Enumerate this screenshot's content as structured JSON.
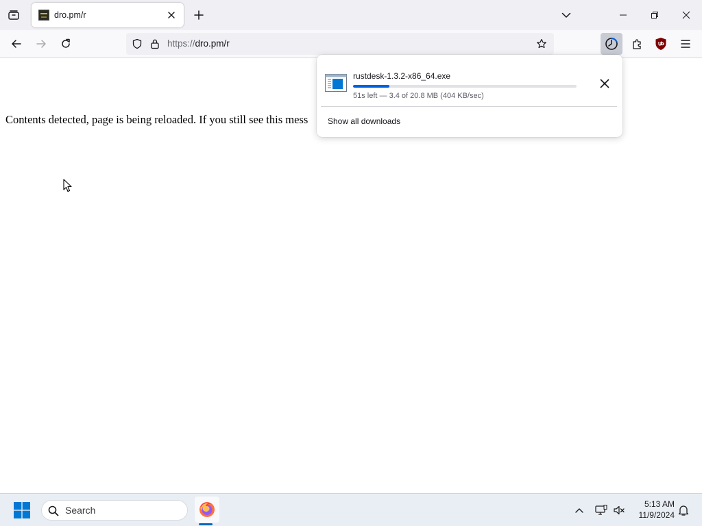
{
  "tab": {
    "title": "dro.pm/r"
  },
  "toolbar": {
    "url_scheme": "https://",
    "url_host": "dro.pm/r"
  },
  "page": {
    "message": "Contents detected, page is being reloaded. If you still see this mess"
  },
  "downloads_panel": {
    "items": [
      {
        "filename": "rustdesk-1.3.2-x86_64.exe",
        "status": "51s left — 3.4 of 20.8 MB (404 KB/sec)",
        "progress_percent": 16.3
      }
    ],
    "show_all_label": "Show all downloads"
  },
  "taskbar": {
    "search_label": "Search",
    "time": "5:13 AM",
    "date": "11/9/2024"
  },
  "colors": {
    "accent": "#0061e0",
    "ublock": "#800000",
    "windows_blue": "#0078d4"
  }
}
